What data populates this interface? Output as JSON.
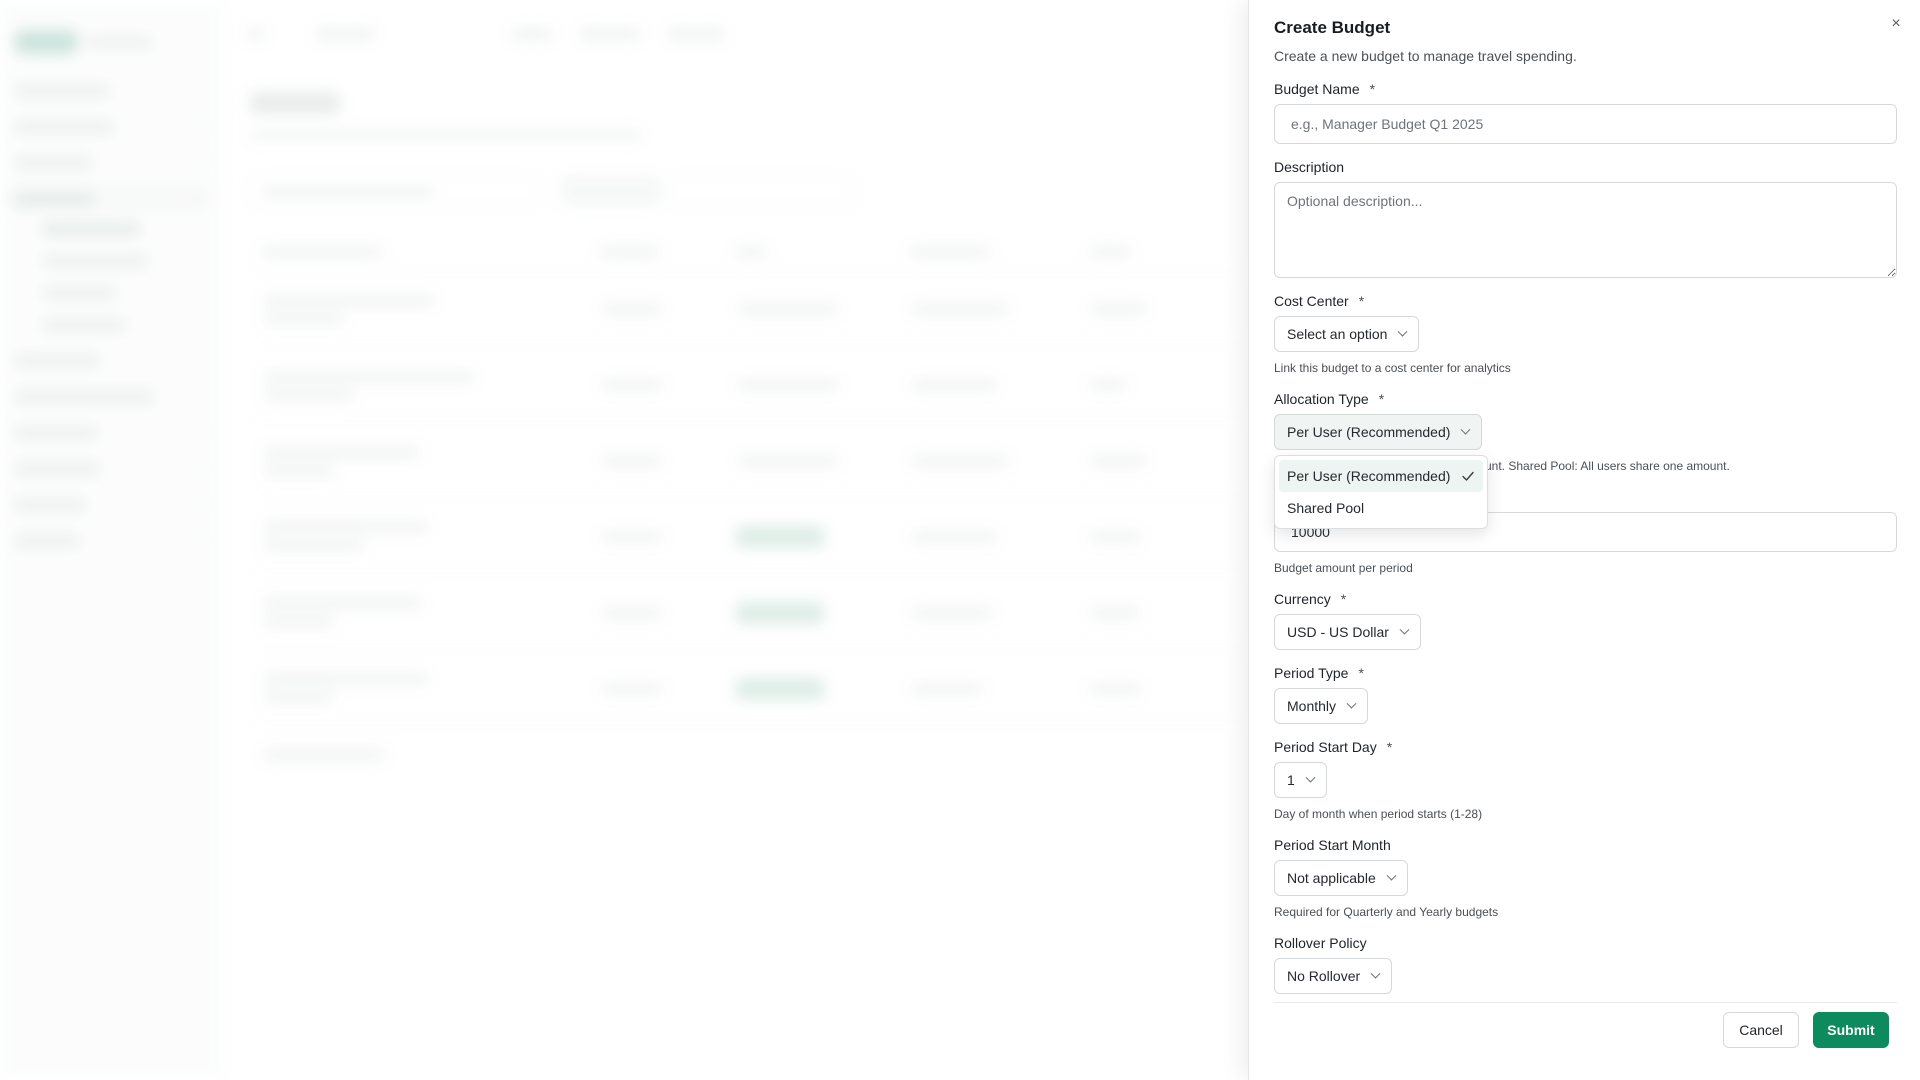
{
  "drawer": {
    "title": "Create Budget",
    "description": "Create a new budget to manage travel spending.",
    "close_icon": "×"
  },
  "fields": {
    "budget_name": {
      "label": "Budget Name",
      "required": "*",
      "placeholder": "e.g., Manager Budget Q1 2025",
      "value": ""
    },
    "description": {
      "label": "Description",
      "placeholder": "Optional description..."
    },
    "cost_center": {
      "label": "Cost Center",
      "required": "*",
      "value": "Select an option",
      "helper": "Link this budget to a cost center for analytics"
    },
    "allocation_type": {
      "label": "Allocation Type",
      "required": "*",
      "value": "Per User (Recommended)",
      "helper_visible": "unt. Shared Pool: All users share one amount.",
      "options": [
        "Per User (Recommended)",
        "Shared Pool"
      ],
      "selected_index": 0
    },
    "amount": {
      "value": "10000",
      "helper": "Budget amount per period"
    },
    "currency": {
      "label": "Currency",
      "required": "*",
      "value": "USD - US Dollar"
    },
    "period_type": {
      "label": "Period Type",
      "required": "*",
      "value": "Monthly"
    },
    "period_start_day": {
      "label": "Period Start Day",
      "required": "*",
      "value": "1",
      "helper": "Day of month when period starts (1-28)"
    },
    "period_start_month": {
      "label": "Period Start Month",
      "value": "Not applicable",
      "helper": "Required for Quarterly and Yearly budgets"
    },
    "rollover_policy": {
      "label": "Rollover Policy",
      "value": "No Rollover"
    }
  },
  "actions": {
    "cancel": "Cancel",
    "submit": "Submit"
  },
  "colors": {
    "primary": "#0e8a5f",
    "menu_selected": "#eef4f1"
  }
}
